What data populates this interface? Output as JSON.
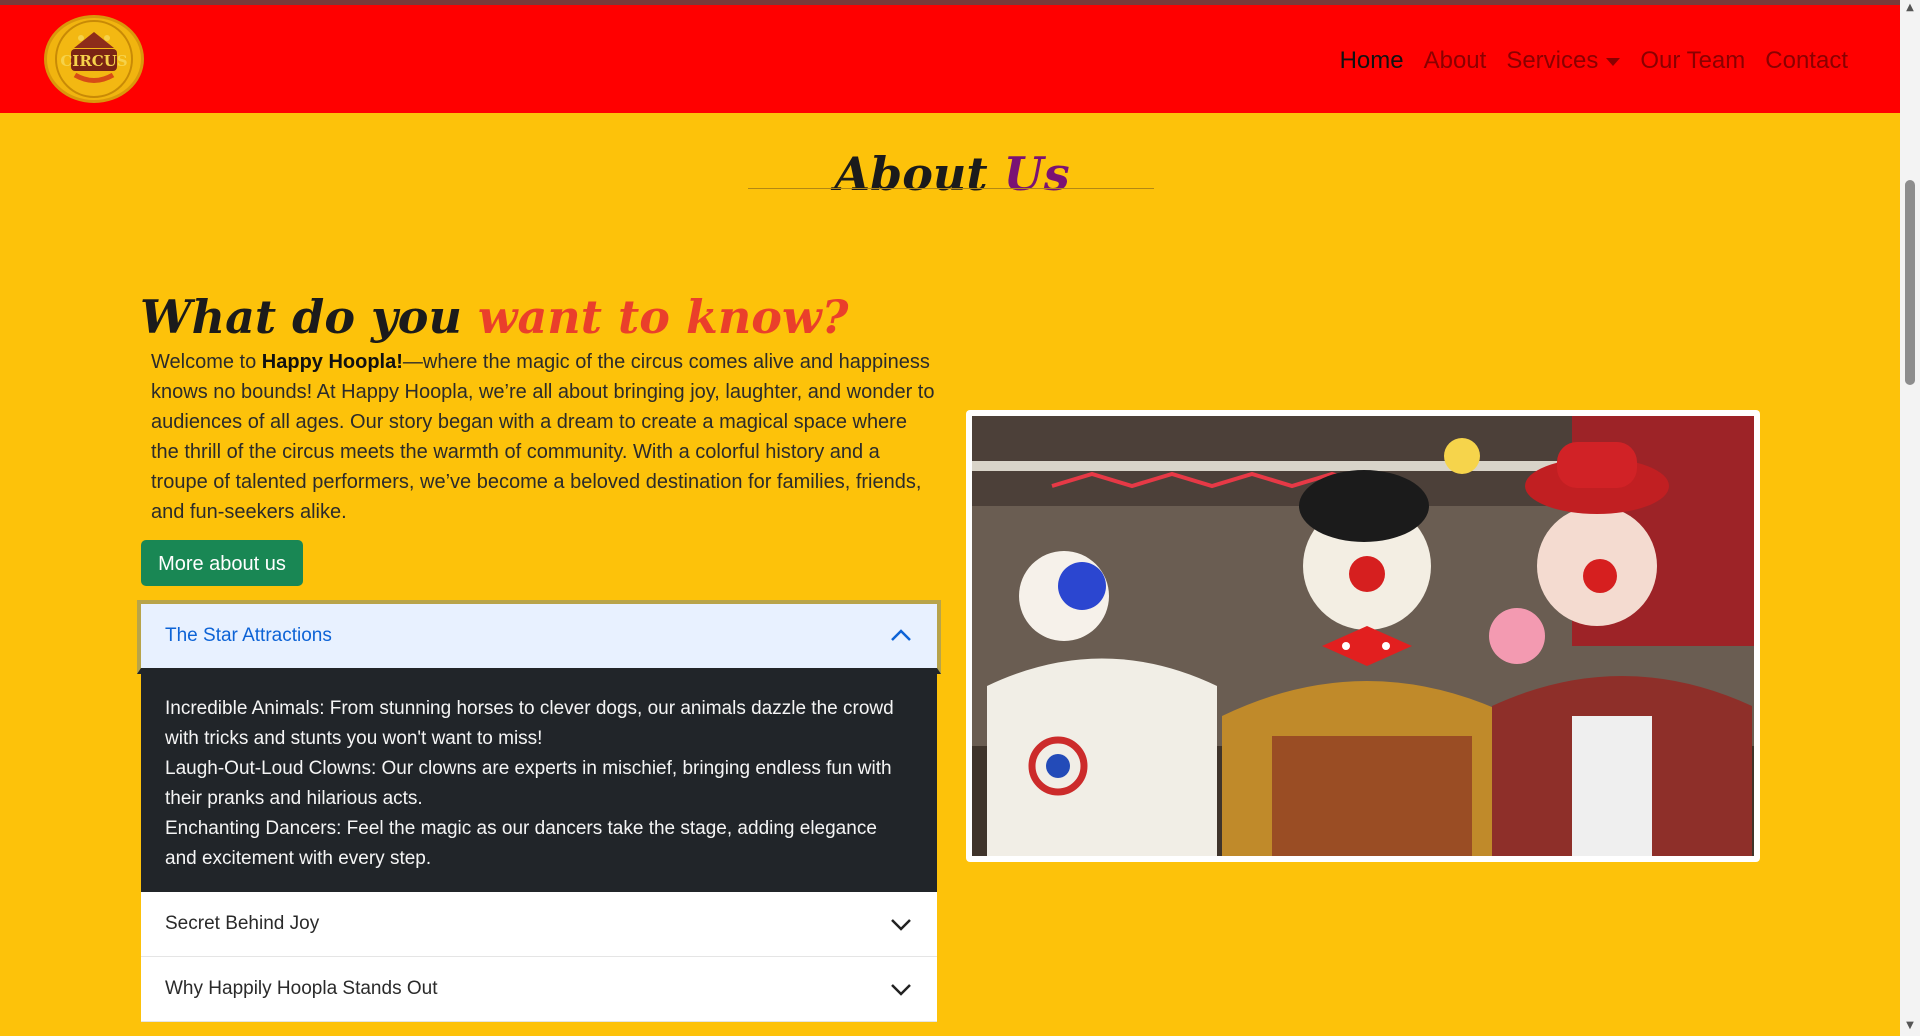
{
  "nav": {
    "logo_text": "CIRCUS",
    "links": [
      {
        "label": "Home",
        "active": true
      },
      {
        "label": "About",
        "active": false
      },
      {
        "label": "Services",
        "active": false
      },
      {
        "label": "Our Team",
        "active": false
      },
      {
        "label": "Contact",
        "active": false
      }
    ]
  },
  "about": {
    "title_main": "About",
    "title_accent": "Us",
    "heading_main": "What do you",
    "heading_accent": "want to know?",
    "intro_before": "Welcome to ",
    "intro_bold": "Happy Hoopla!",
    "intro_after": "—where the magic of the circus comes alive and happiness knows no bounds! At Happy Hoopla, we’re all about bringing joy, laughter, and wonder to audiences of all ages. Our story began with a dream to create a magical space where the thrill of the circus meets the warmth of community. With a colorful history and a troupe of talented performers, we’ve become a beloved destination for families, friends, and fun-seekers alike.",
    "more_button": "More about us"
  },
  "accordion": {
    "items": [
      {
        "label": "The Star Attractions",
        "expanded": true,
        "body": [
          "Incredible Animals: From stunning horses to clever dogs, our animals dazzle the crowd with tricks and stunts you won't want to miss!",
          "Laugh-Out-Loud Clowns: Our clowns are experts in mischief, bringing endless fun with their pranks and hilarious acts.",
          "Enchanting Dancers: Feel the magic as our dancers take the stage, adding elegance and excitement with every step."
        ]
      },
      {
        "label": "Secret Behind Joy",
        "expanded": false
      },
      {
        "label": "Why Happily Hoopla Stands Out",
        "expanded": false
      }
    ]
  },
  "colors": {
    "page_bg": "#fdc20a",
    "navbar_bg": "#ff0000",
    "button_green": "#198754",
    "accordion_dark": "#212529",
    "accordion_active": "#0d63d6"
  }
}
